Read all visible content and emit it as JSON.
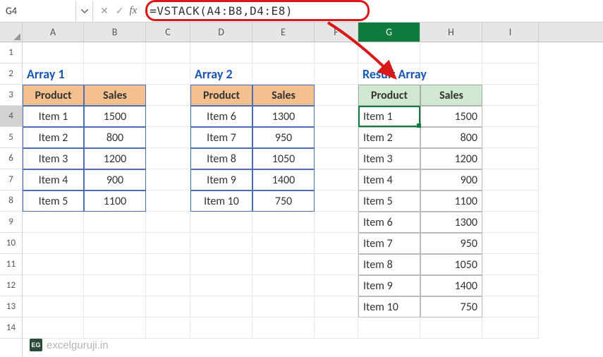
{
  "namebox": "G4",
  "formula": "=VSTACK(A4:B8,D4:E8)",
  "columns": [
    "A",
    "B",
    "C",
    "D",
    "E",
    "F",
    "G",
    "H",
    "I"
  ],
  "rows": [
    "1",
    "2",
    "3",
    "4",
    "5",
    "6",
    "7",
    "8",
    "9",
    "10",
    "11",
    "12",
    "13",
    "14"
  ],
  "labels": {
    "array1": "Array 1",
    "array2": "Array 2",
    "result": "Result Array",
    "product": "Product",
    "sales": "Sales"
  },
  "array1": [
    {
      "p": "Item 1",
      "s": "1500"
    },
    {
      "p": "Item 2",
      "s": "800"
    },
    {
      "p": "Item 3",
      "s": "1200"
    },
    {
      "p": "Item 4",
      "s": "900"
    },
    {
      "p": "Item 5",
      "s": "1100"
    }
  ],
  "array2": [
    {
      "p": "Item 6",
      "s": "1300"
    },
    {
      "p": "Item 7",
      "s": "950"
    },
    {
      "p": "Item 8",
      "s": "1050"
    },
    {
      "p": "Item 9",
      "s": "1400"
    },
    {
      "p": "Item 10",
      "s": "750"
    }
  ],
  "result": [
    {
      "p": "Item 1",
      "s": "1500"
    },
    {
      "p": "Item 2",
      "s": "800"
    },
    {
      "p": "Item 3",
      "s": "1200"
    },
    {
      "p": "Item 4",
      "s": "900"
    },
    {
      "p": "Item 5",
      "s": "1100"
    },
    {
      "p": "Item 6",
      "s": "1300"
    },
    {
      "p": "Item 7",
      "s": "950"
    },
    {
      "p": "Item 8",
      "s": "1050"
    },
    {
      "p": "Item 9",
      "s": "1400"
    },
    {
      "p": "Item 10",
      "s": "750"
    }
  ],
  "watermark": "excelguruji.in",
  "wmlogo": "EG"
}
